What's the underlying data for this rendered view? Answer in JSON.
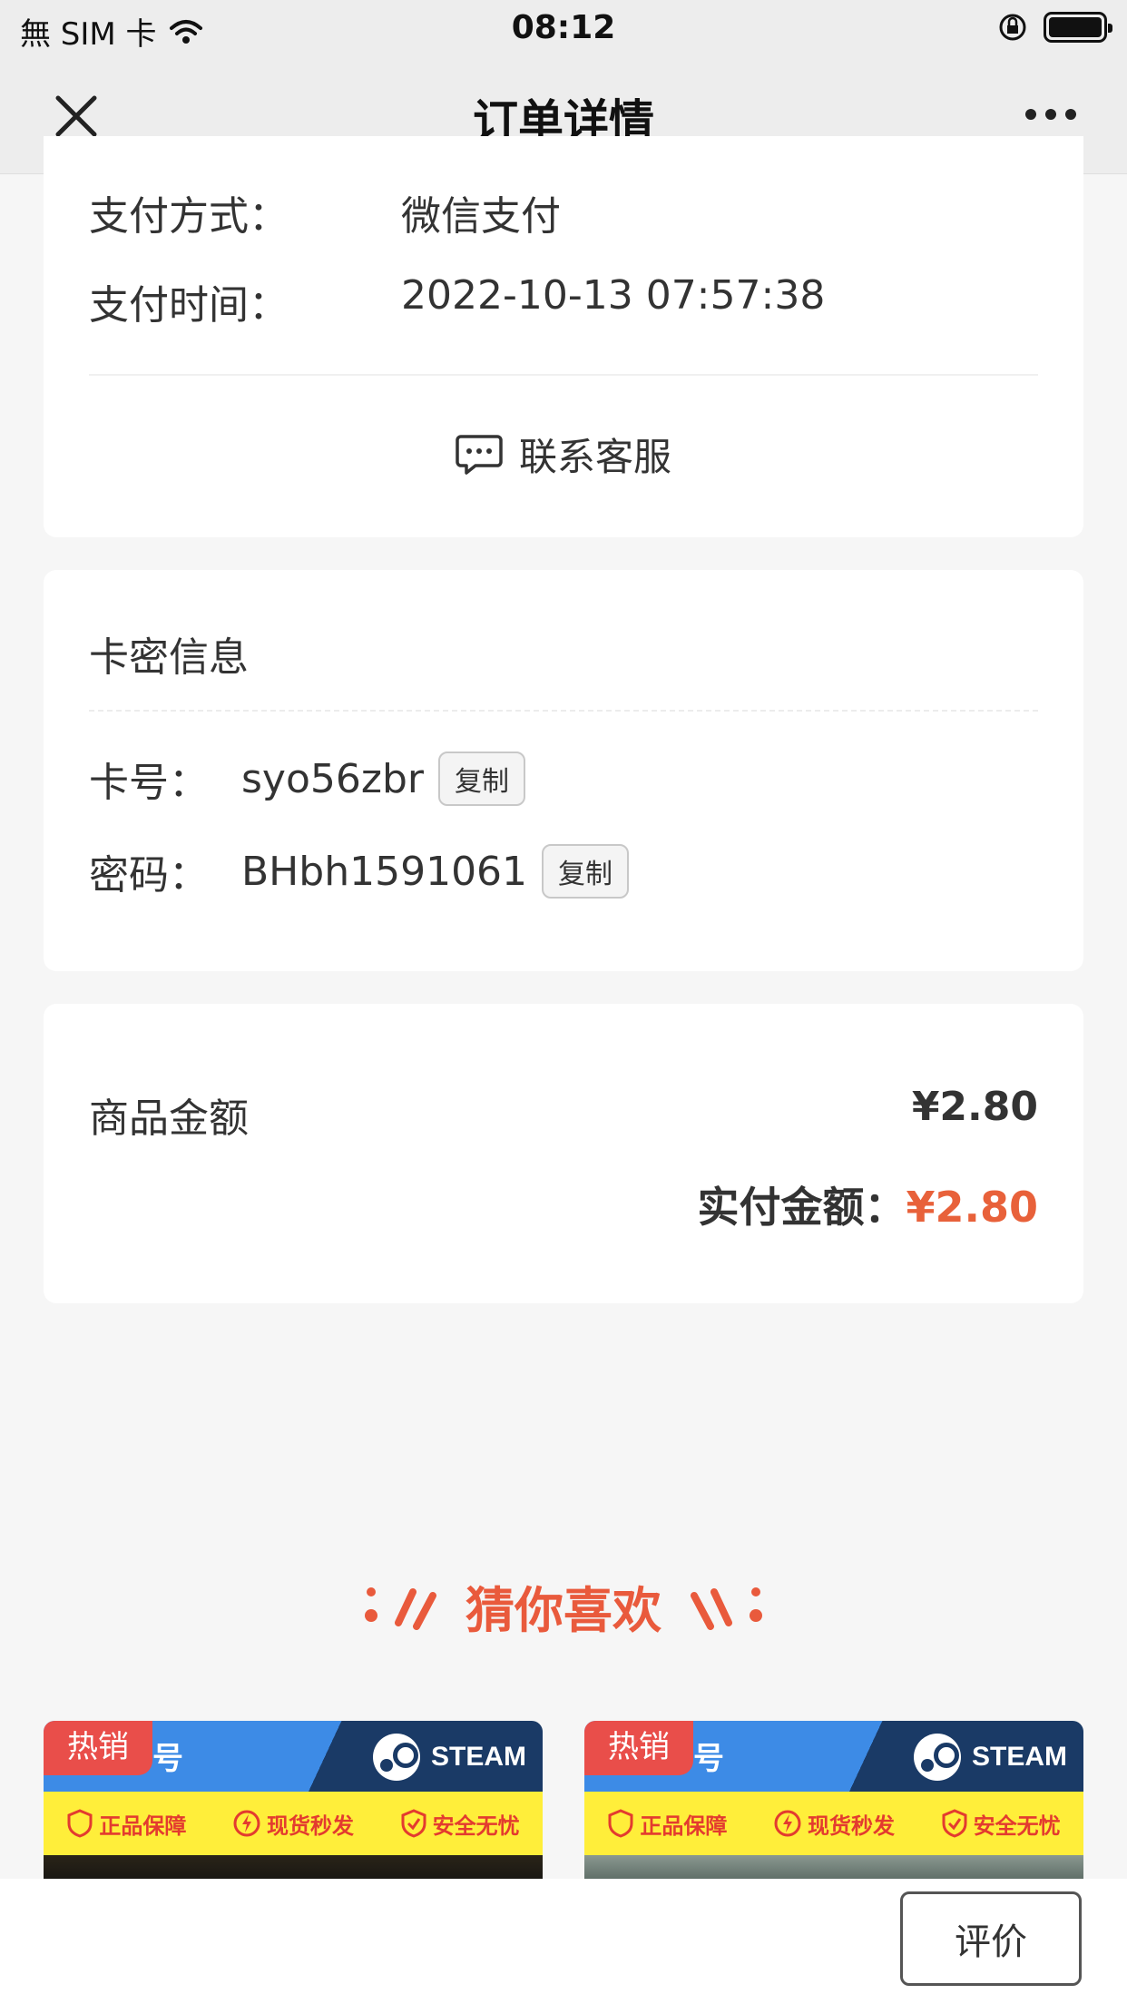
{
  "status_bar": {
    "carrier": "無 SIM 卡",
    "time": "08:12"
  },
  "nav": {
    "title": "订单详情"
  },
  "payment": {
    "method_label": "支付方式：",
    "method_value": "微信支付",
    "time_label": "支付时间：",
    "time_value": "2022-10-13 07:57:38",
    "contact_label": "联系客服"
  },
  "card_secret": {
    "title": "卡密信息",
    "card_no_label": "卡号：",
    "card_no_value": "syo56zbr",
    "password_label": "密码：",
    "password_value": "BHbh1591061",
    "copy_label": "复制"
  },
  "amount": {
    "goods_label": "商品金额",
    "goods_value": "¥2.80",
    "paid_label": "实付金额：",
    "paid_value": "¥2.80",
    "accent_color": "#e8613a"
  },
  "recommend": {
    "title": "猜你喜欢",
    "products": [
      {
        "tag": "热销",
        "title_fragment": "号",
        "brand": "STEAM",
        "features": [
          "正品保障",
          "现货秒发",
          "安全无忧"
        ]
      },
      {
        "tag": "热销",
        "title_fragment": "号",
        "brand": "STEAM",
        "features": [
          "正品保障",
          "现货秒发",
          "安全无忧"
        ]
      }
    ]
  },
  "bottom": {
    "review_label": "评价"
  }
}
